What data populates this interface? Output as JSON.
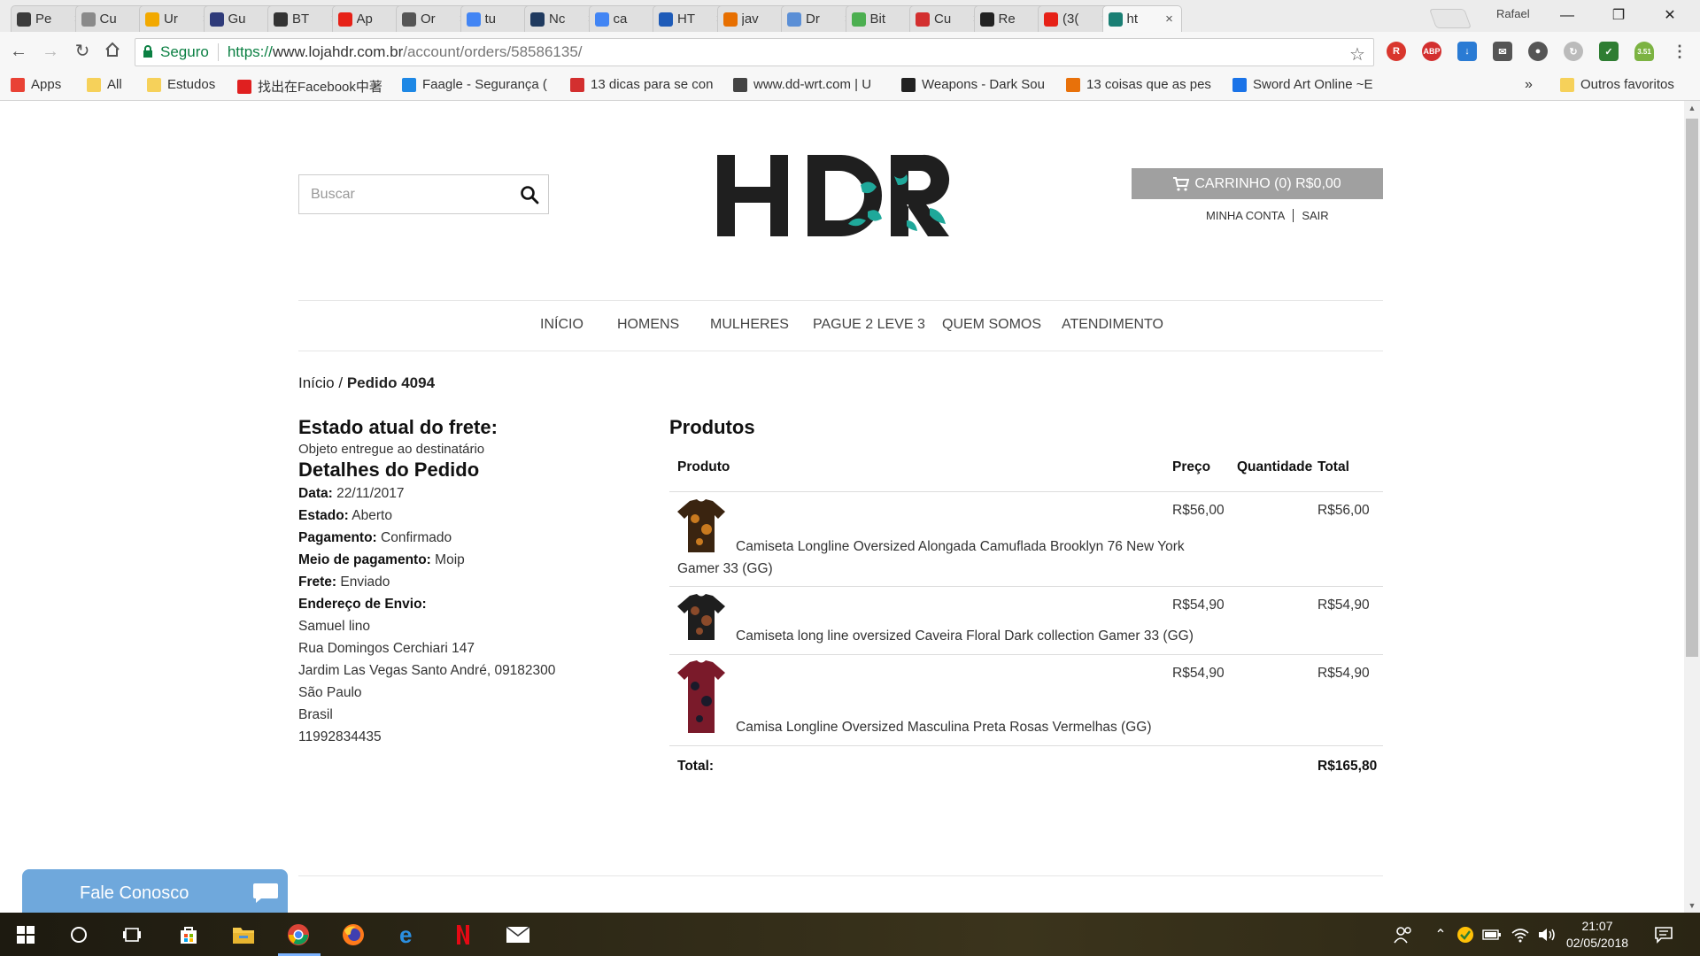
{
  "browser": {
    "tabs": [
      {
        "title": "Pe",
        "icon": "tab-favicon-pe",
        "color": "#3b3b3b"
      },
      {
        "title": "Cu",
        "icon": "tab-favicon-cu",
        "color": "#8a8a8a"
      },
      {
        "title": "Ur",
        "icon": "bitcoin-icon",
        "color": "#f2a900"
      },
      {
        "title": "Gu",
        "icon": "chart-icon",
        "color": "#2f3b7a"
      },
      {
        "title": "BT",
        "icon": "investing-icon",
        "color": "#333333"
      },
      {
        "title": "Ap",
        "icon": "youtube-icon",
        "color": "#e62117"
      },
      {
        "title": "Or",
        "icon": "book-icon",
        "color": "#555555"
      },
      {
        "title": "tu",
        "icon": "google-icon",
        "color": "#4285f4"
      },
      {
        "title": "Nc",
        "icon": "tab-favicon-nc",
        "color": "#1f3a5f"
      },
      {
        "title": "ca",
        "icon": "google-icon",
        "color": "#4285f4"
      },
      {
        "title": "HT",
        "icon": "html5-icon",
        "color": "#1e5bb8"
      },
      {
        "title": "jav",
        "icon": "java-icon",
        "color": "#e76f00"
      },
      {
        "title": "Dr",
        "icon": "cloud-icon",
        "color": "#5b8fd6"
      },
      {
        "title": "Bit",
        "icon": "leaf-icon",
        "color": "#4caf50"
      },
      {
        "title": "Cu",
        "icon": "tab-favicon-u",
        "color": "#d32f2f"
      },
      {
        "title": "Re",
        "icon": "wikipedia-icon",
        "color": "#222222"
      },
      {
        "title": "(3(",
        "icon": "youtube-icon",
        "color": "#e62117"
      },
      {
        "title": "ht",
        "icon": "hdr-favicon",
        "color": "#1a7f74"
      }
    ],
    "profile_name": "Rafael",
    "address": {
      "secure_label": "Seguro",
      "url_scheme": "https://",
      "url_host": "www.lojahdr.com.br",
      "url_path": "/account/orders/58586135/"
    },
    "bookmarks": [
      {
        "label": "Apps",
        "icon": "apps-grid-icon",
        "color": "#e94235"
      },
      {
        "label": "All",
        "icon": "folder-icon",
        "color": "#f6d15a"
      },
      {
        "label": "Estudos",
        "icon": "folder-icon",
        "color": "#f6d15a"
      },
      {
        "label": "找出在Facebook中著",
        "icon": "flash-icon",
        "color": "#e02020"
      },
      {
        "label": "Faagle - Segurança (",
        "icon": "faagle-icon",
        "color": "#1e88e5"
      },
      {
        "label": "13 dicas para se con",
        "icon": "e-icon",
        "color": "#d32f2f"
      },
      {
        "label": "www.dd-wrt.com | U",
        "icon": "ddwrt-icon",
        "color": "#444444"
      },
      {
        "label": "Weapons - Dark Sou",
        "icon": "darksouls-icon",
        "color": "#222222"
      },
      {
        "label": "13 coisas que as pes",
        "icon": "hs-icon",
        "color": "#e8710a"
      },
      {
        "label": "Sword Art Online ~E",
        "icon": "sao-icon",
        "color": "#1a73e8"
      }
    ],
    "bookmarks_more": "»",
    "other_bookmarks": "Outros favoritos"
  },
  "site": {
    "search_placeholder": "Buscar",
    "logo_text": "HDR",
    "cart_label": "CARRINHO (0) R$0,00",
    "account_link": "MINHA CONTA",
    "logout_link": "SAIR",
    "menu": [
      "INÍCIO",
      "HOMENS",
      "MULHERES",
      "PAGUE 2 LEVE 3",
      "QUEM SOMOS",
      "ATENDIMENTO"
    ],
    "breadcrumb": {
      "home": "Início",
      "separator": " / ",
      "current": "Pedido 4094"
    }
  },
  "order": {
    "shipping_status_title": "Estado atual do frete:",
    "shipping_status": "Objeto entregue ao destinatário",
    "details_title": "Detalhes do Pedido",
    "fields": [
      {
        "label": "Data:",
        "value": " 22/11/2017"
      },
      {
        "label": "Estado:",
        "value": " Aberto"
      },
      {
        "label": "Pagamento:",
        "value": " Confirmado"
      },
      {
        "label": "Meio de pagamento:",
        "value": " Moip"
      },
      {
        "label": "Frete:",
        "value": " Enviado"
      }
    ],
    "address_label": "Endereço de Envio:",
    "address_lines": [
      "Samuel lino",
      "Rua Domingos Cerchiari 147",
      "Jardim Las Vegas Santo André, 09182300",
      "São Paulo",
      "Brasil",
      "11992834435"
    ]
  },
  "products": {
    "title": "Produtos",
    "headers": {
      "product": "Produto",
      "price": "Preço",
      "quantity": "Quantidade",
      "total": "Total"
    },
    "items": [
      {
        "name_line1": "Camiseta Longline Oversized Alongada Camuflada Brooklyn 76 New York",
        "name_line2": "Gamer 33 (GG)",
        "price": "R$56,00",
        "quantity": "",
        "total": "R$56,00",
        "shirt_color": "#3a2410",
        "accent_color": "#c97a1f"
      },
      {
        "name_line1": "Camiseta long line oversized Caveira Floral Dark collection Gamer 33 (GG)",
        "name_line2": "",
        "price": "R$54,90",
        "quantity": "",
        "total": "R$54,90",
        "shirt_color": "#1e1e1e",
        "accent_color": "#8a4a2a"
      },
      {
        "name_line1": "Camisa Longline Oversized Masculina Preta Rosas Vermelhas (GG)",
        "name_line2": "",
        "price": "R$54,90",
        "quantity": "",
        "total": "R$54,90",
        "shirt_color": "#7a1a2a",
        "accent_color": "#1a1a2a"
      }
    ],
    "total_label": "Total:",
    "total_value": "R$165,80"
  },
  "chat": {
    "label": "Fale Conosco"
  },
  "taskbar": {
    "time": "21:07",
    "date": "02/05/2018"
  },
  "colors": {
    "logo_dark": "#1f1f1f",
    "logo_accent": "#1fa89a",
    "cart_bg": "#a0a0a0",
    "chat_bg": "#6fa8dc",
    "secure_green": "#0b8043"
  }
}
